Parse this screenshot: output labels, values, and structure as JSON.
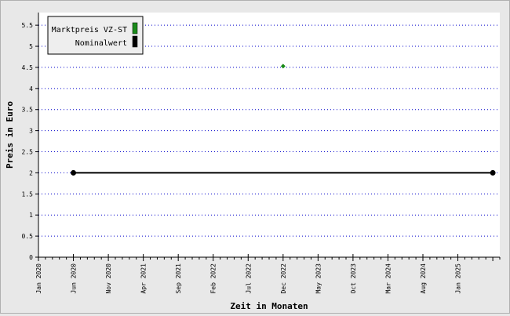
{
  "chart_data": {
    "type": "line",
    "title": "",
    "xlabel": "Zeit in Monaten",
    "ylabel": "Preis in Euro",
    "ylim": [
      0,
      5.8
    ],
    "xlim": [
      "2020-01",
      "2025-07"
    ],
    "y_ticks": [
      "0",
      "0.5",
      "1",
      "1.5",
      "2",
      "2.5",
      "3",
      "3.5",
      "4",
      "4.5",
      "5",
      "5.5"
    ],
    "x_tick_labels": [
      {
        "date": "2020-01",
        "label": "Jan 2020"
      },
      {
        "date": "2020-06",
        "label": "Jun 2020"
      },
      {
        "date": "2020-11",
        "label": "Nov 2020"
      },
      {
        "date": "2021-04",
        "label": "Apr 2021"
      },
      {
        "date": "2021-09",
        "label": "Sep 2021"
      },
      {
        "date": "2022-02",
        "label": "Feb 2022"
      },
      {
        "date": "2022-07",
        "label": "Jul 2022"
      },
      {
        "date": "2022-12",
        "label": "Dec 2022"
      },
      {
        "date": "2023-05",
        "label": "May 2023"
      },
      {
        "date": "2023-10",
        "label": "Oct 2023"
      },
      {
        "date": "2024-03",
        "label": "Mar 2024"
      },
      {
        "date": "2024-08",
        "label": "Aug 2024"
      },
      {
        "date": "2025-01",
        "label": "Jan 2025"
      }
    ],
    "grid": "horizontal dotted",
    "legend_position": "top-left",
    "series": [
      {
        "name": "Marktpreis VZ-ST",
        "color": "#1a8a1a",
        "style": "marker",
        "points": [
          {
            "x": "2022-12",
            "y": 4.53
          }
        ]
      },
      {
        "name": "Nominalwert",
        "color": "#000000",
        "style": "line",
        "points": [
          {
            "x": "2020-06",
            "y": 2
          },
          {
            "x": "2025-06",
            "y": 2
          }
        ]
      }
    ]
  }
}
